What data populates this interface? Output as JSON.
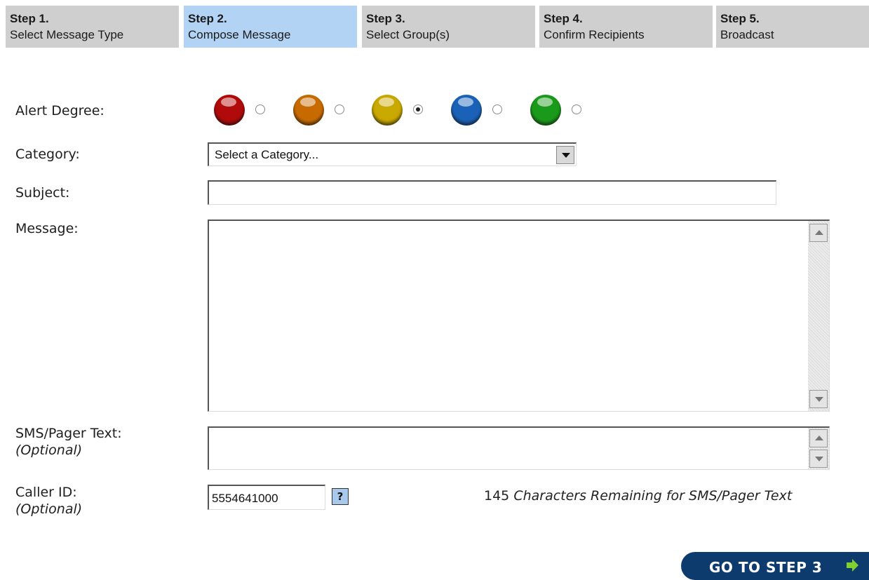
{
  "steps": [
    {
      "num": "Step 1.",
      "name": "Select Message Type"
    },
    {
      "num": "Step 2.",
      "name": "Compose Message"
    },
    {
      "num": "Step 3.",
      "name": "Select Group(s)"
    },
    {
      "num": "Step 4.",
      "name": "Confirm Recipients"
    },
    {
      "num": "Step 5.",
      "name": "Broadcast"
    }
  ],
  "active_step": 2,
  "form": {
    "alert_label": "Alert Degree:",
    "alert_levels": [
      {
        "color": "#b10a0a",
        "selected": false
      },
      {
        "color": "#c76a00",
        "selected": false
      },
      {
        "color": "#c9a800",
        "selected": true
      },
      {
        "color": "#1a62b8",
        "selected": false
      },
      {
        "color": "#1a9a1a",
        "selected": false
      }
    ],
    "category_label": "Category:",
    "category_value": "Select a Category...",
    "subject_label": "Subject:",
    "subject_value": "",
    "message_label": "Message:",
    "message_value": "",
    "sms_label": "SMS/Pager Text:",
    "sms_optional": "(Optional)",
    "sms_value": "",
    "callerid_label": "Caller ID:",
    "callerid_optional": "(Optional)",
    "callerid_value": "5554641000",
    "help_label": "?",
    "remaining_count": "145",
    "remaining_text": "Characters Remaining for SMS/Pager Text"
  },
  "go_button": {
    "label": "GO TO STEP 3",
    "icon": "arrow-right-icon"
  }
}
